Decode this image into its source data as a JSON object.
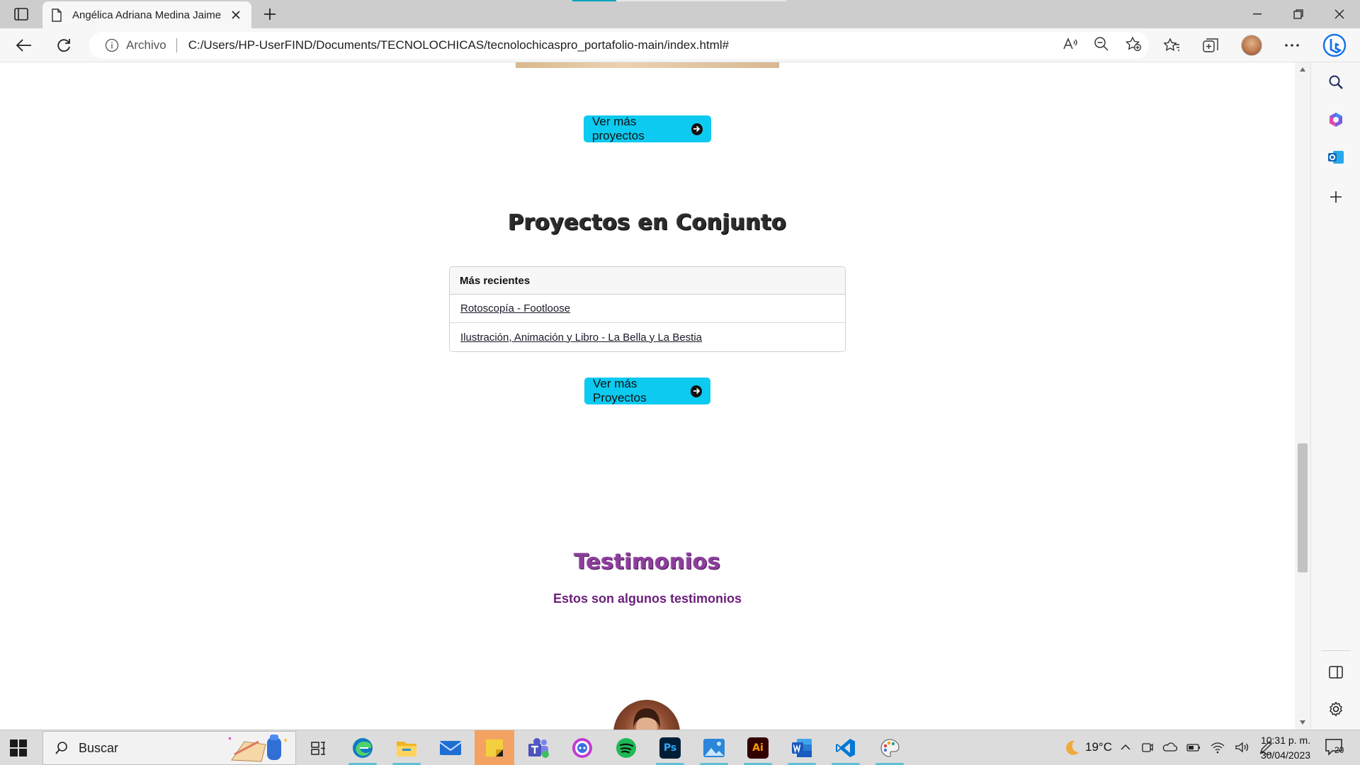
{
  "browser": {
    "tab_title": "Angélica Adriana Medina Jaime |",
    "address_label": "Archivo",
    "url": "C:/Users/HP-UserFIND/Documents/TECNOLOCHICAS/tecnolochicaspro_portafolio-main/index.html#"
  },
  "page": {
    "btn_more_projects_1": "Ver más proyectos",
    "joint_projects_title": "Proyectos en Conjunto",
    "list_header": "Más recientes",
    "list_items": [
      "Rotoscopía - Footloose",
      "Ilustración, Animación y Libro - La Bella y La Bestia"
    ],
    "btn_more_projects_2": "Ver más Proyectos",
    "testimonials_title": "Testimonios",
    "testimonials_subtitle": "Estos son algunos testimonios"
  },
  "taskbar": {
    "search_placeholder": "Buscar",
    "apps": [
      "task-view",
      "edge",
      "file-explorer",
      "mail",
      "sticky-notes",
      "teams",
      "discord-like",
      "spotify",
      "photoshop",
      "photos",
      "illustrator",
      "word",
      "vscode",
      "paint"
    ],
    "temperature": "19°C",
    "time": "10:31 p. m.",
    "date": "30/04/2023",
    "notification_count": "20"
  },
  "colors": {
    "accent_button": "#0dcaf0",
    "testimonial_purple": "#6a1f7a"
  }
}
